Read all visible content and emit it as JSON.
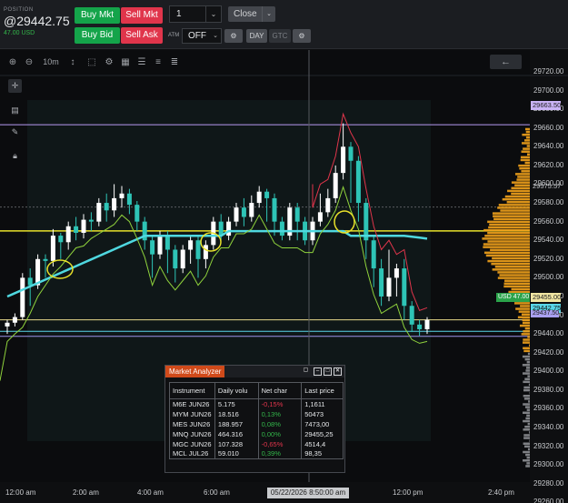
{
  "position": {
    "caption": "POSITION",
    "price": "@29442.75",
    "pnl": "47.00 USD"
  },
  "order_buttons": {
    "buy_mkt": "Buy Mkt",
    "sell_mkt": "Sell Mkt",
    "buy_bid": "Buy Bid",
    "sell_ask": "Sell Ask"
  },
  "quantity": "1",
  "close_label": "Close",
  "atm": {
    "label": "ATM",
    "value": "OFF"
  },
  "buttons": {
    "day": "DAY",
    "gtc": "GTC"
  },
  "chart_toolbar": {
    "zoom_level": "10m"
  },
  "y_axis": {
    "ticks": [
      "29720.00",
      "29700.00",
      "29680.00",
      "29660.00",
      "29640.00",
      "29620.00",
      "29600.00",
      "29580.00",
      "29560.00",
      "29540.00",
      "29520.00",
      "29500.00",
      "29480.00",
      "29460.00",
      "29440.00",
      "29420.00",
      "29400.00",
      "29380.00",
      "29360.00",
      "29340.00",
      "29320.00",
      "29300.00",
      "29280.00",
      "29260.00"
    ]
  },
  "x_axis": {
    "ticks": [
      "12:00 am",
      "2:00 am",
      "4:00 am",
      "6:00 am",
      "12:00 pm",
      "2:40 pm"
    ]
  },
  "price_tags": {
    "high": "29663.50",
    "level_1": "29575.57",
    "usd": "USD 47.00",
    "entry": "29455.00",
    "last": "29442.75",
    "low": "29437.50"
  },
  "cursor_time": "05/22/2026 8:50:00 am",
  "colors": {
    "up_candle": "#ffffff",
    "down_candle": "#2ec4b6",
    "moving_average": "#4fd8e0",
    "fast_line": "#8fd23c",
    "level_line": "#e8e12a",
    "volume_profile": "#f2a21b",
    "buy": "#14a44a",
    "sell": "#e0354b"
  },
  "market_analyzer": {
    "title": "Market Analyzer",
    "columns": [
      "Instrument",
      "Daily volu",
      "Net char",
      "Last price"
    ],
    "rows": [
      {
        "instrument": "M6E JUN26",
        "volume": "5.175",
        "net_change": "-0,15%",
        "last": "1,1611",
        "direction": "down"
      },
      {
        "instrument": "MYM JUN26",
        "volume": "18.516",
        "net_change": "0,13%",
        "last": "50473",
        "direction": "up"
      },
      {
        "instrument": "MES JUN26",
        "volume": "188.957",
        "net_change": "0,08%",
        "last": "7473,00",
        "direction": "up"
      },
      {
        "instrument": "MNQ JUN26",
        "volume": "464.316",
        "net_change": "0,00%",
        "last": "29455,25",
        "direction": "up"
      },
      {
        "instrument": "MGC JUN26",
        "volume": "107.328",
        "net_change": "-0,65%",
        "last": "4514,4",
        "direction": "down"
      },
      {
        "instrument": "MCL JUL26",
        "volume": "59.010",
        "net_change": "0,39%",
        "last": "98,35",
        "direction": "up"
      }
    ]
  }
}
